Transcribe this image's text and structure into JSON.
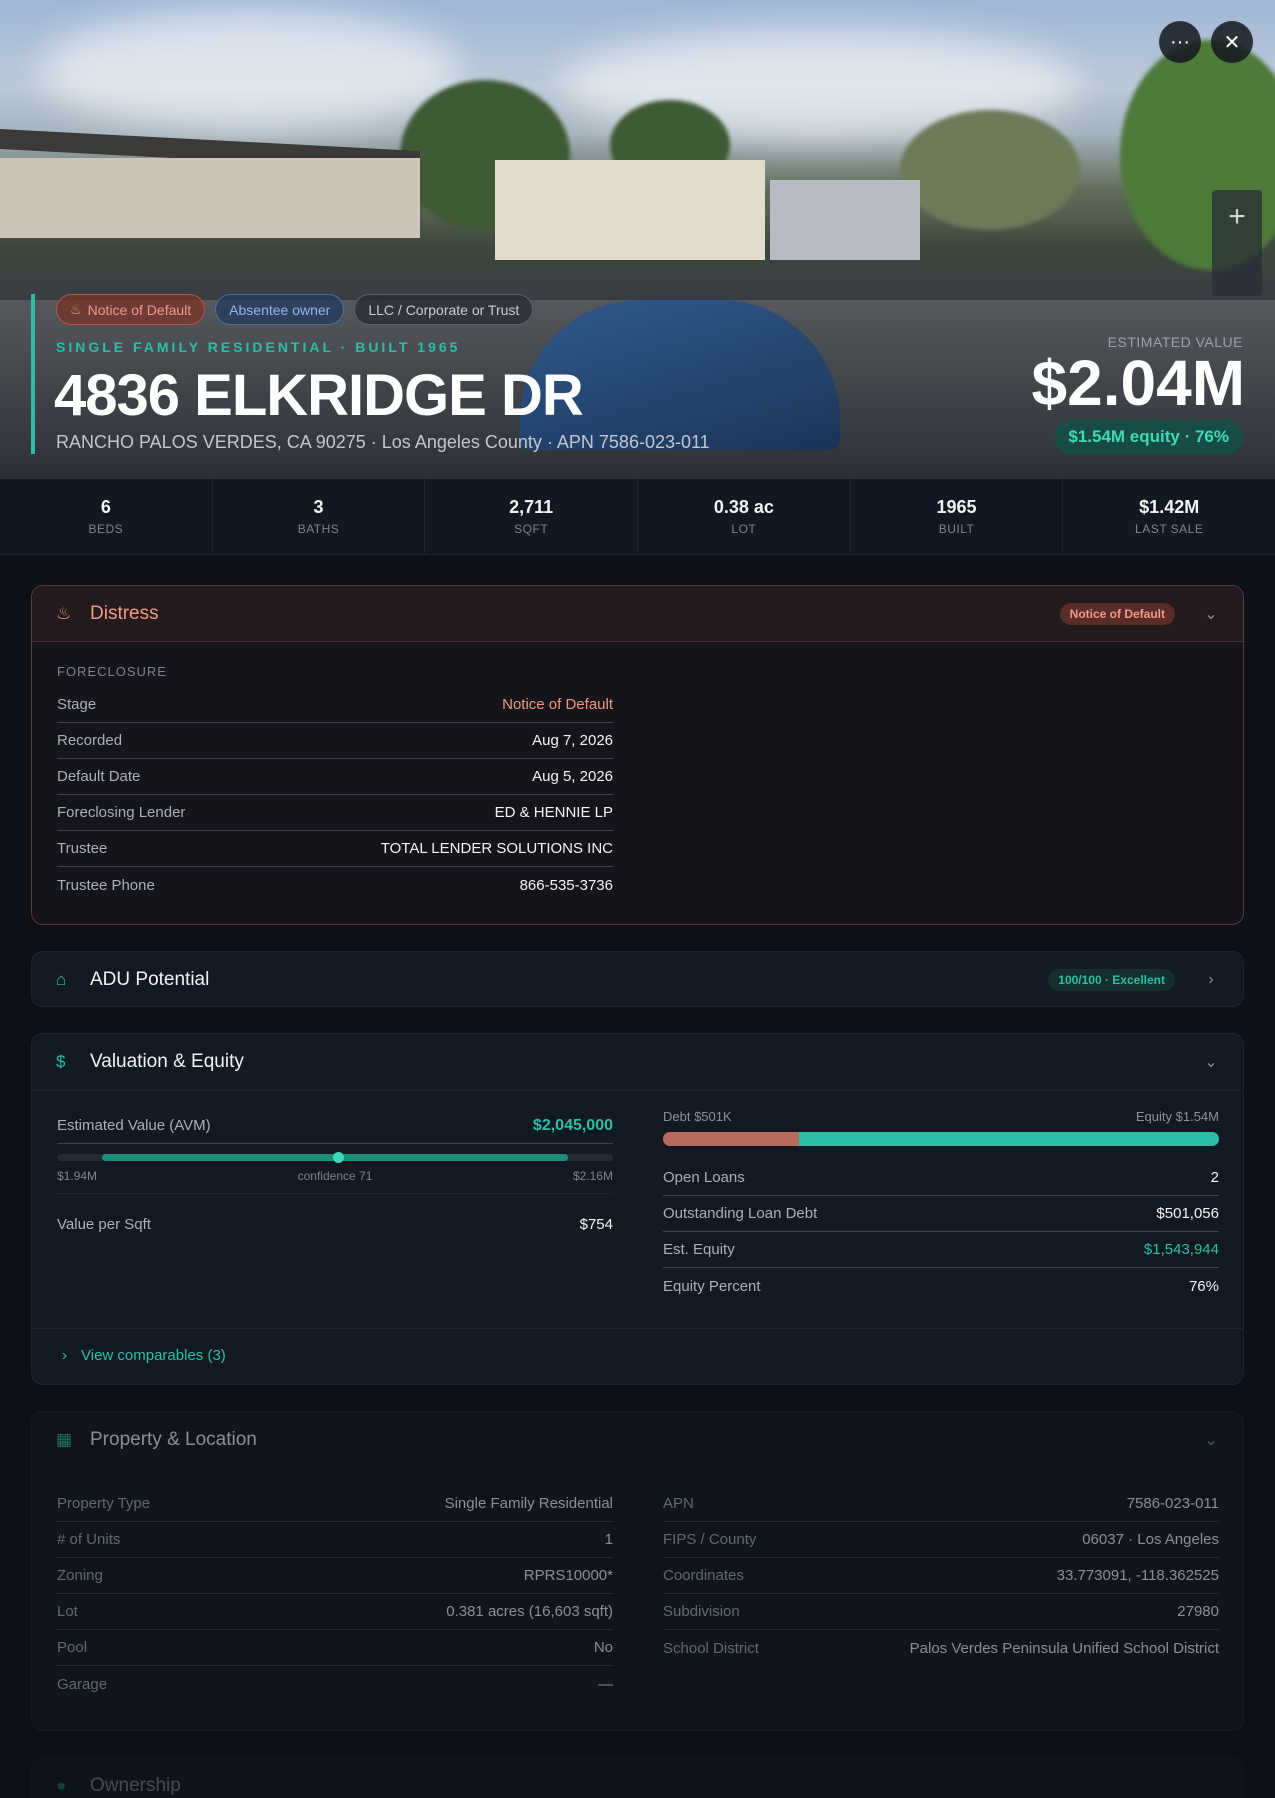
{
  "hero": {
    "badges": [
      {
        "label": "Notice of Default",
        "icon": "flame-icon"
      },
      {
        "label": "Absentee owner"
      },
      {
        "label": "LLC / Corporate or Trust"
      }
    ],
    "subtype": "SINGLE FAMILY RESIDENTIAL · BUILT 1965",
    "address": "4836 ELKRIDGE DR",
    "location": "RANCHO PALOS VERDES, CA 90275 · Los Angeles County · APN 7586-023-011",
    "estimated_label": "ESTIMATED VALUE",
    "estimated_value": "$2.04M",
    "equity_pill": "$1.54M equity · 76%",
    "more_icon": "···",
    "close_icon": "✕",
    "zoom_in": "+",
    "zoom_out": ""
  },
  "stats": [
    {
      "value": "6",
      "label": "BEDS"
    },
    {
      "value": "3",
      "label": "BATHS"
    },
    {
      "value": "2,711",
      "label": "SQFT"
    },
    {
      "value": "0.38 ac",
      "label": "LOT"
    },
    {
      "value": "1965",
      "label": "BUILT"
    },
    {
      "value": "$1.42M",
      "label": "LAST SALE"
    }
  ],
  "distress": {
    "title": "Distress",
    "badge": "Notice of Default",
    "section_label": "FORECLOSURE",
    "rows": [
      {
        "k": "Stage",
        "v": "Notice of Default"
      },
      {
        "k": "Recorded",
        "v": "Aug 7, 2026"
      },
      {
        "k": "Default Date",
        "v": "Aug 5, 2026"
      },
      {
        "k": "Foreclosing Lender",
        "v": "ED & HENNIE LP"
      },
      {
        "k": "Trustee",
        "v": "TOTAL LENDER SOLUTIONS INC"
      },
      {
        "k": "Trustee Phone",
        "v": "866-535-3736"
      }
    ]
  },
  "adu": {
    "title": "ADU Potential",
    "score": "100/100 · Excellent"
  },
  "valuation": {
    "title": "Valuation & Equity",
    "avm_label": "Estimated Value (AVM)",
    "avm_value": "$2,045,000",
    "range_low": "$1.94M",
    "range_mid": "confidence 71",
    "range_high": "$2.16M",
    "per_sqft_label": "Value per Sqft",
    "per_sqft_value": "$754",
    "debt_label": "Debt $501K",
    "equity_label": "Equity $1.54M",
    "debt_fraction": 0.245,
    "rows": [
      {
        "k": "Open Loans",
        "v": "2"
      },
      {
        "k": "Outstanding Loan Debt",
        "v": "$501,056"
      },
      {
        "k": "Est. Equity",
        "v": "$1,543,944"
      },
      {
        "k": "Equity Percent",
        "v": "76%"
      }
    ],
    "comparables_link": "View comparables (3)"
  },
  "property": {
    "title": "Property & Location",
    "left": [
      {
        "k": "Property Type",
        "v": "Single Family Residential"
      },
      {
        "k": "# of Units",
        "v": "1"
      },
      {
        "k": "Zoning",
        "v": "RPRS10000*"
      },
      {
        "k": "Lot",
        "v": "0.381 acres (16,603 sqft)"
      },
      {
        "k": "Pool",
        "v": "No"
      },
      {
        "k": "Garage",
        "v": "—"
      }
    ],
    "right": [
      {
        "k": "APN",
        "v": "7586-023-011"
      },
      {
        "k": "FIPS / County",
        "v": "06037 · Los Angeles"
      },
      {
        "k": "Coordinates",
        "v": "33.773091, -118.362525"
      },
      {
        "k": "Subdivision",
        "v": "27980"
      },
      {
        "k": "School District",
        "v": "Palos Verdes Peninsula Unified School District"
      }
    ]
  },
  "ownership": {
    "title": "Ownership"
  },
  "colors": {
    "accent": "#2bbfa6",
    "distress": "#f09a86",
    "debt": "#b96a5f"
  }
}
